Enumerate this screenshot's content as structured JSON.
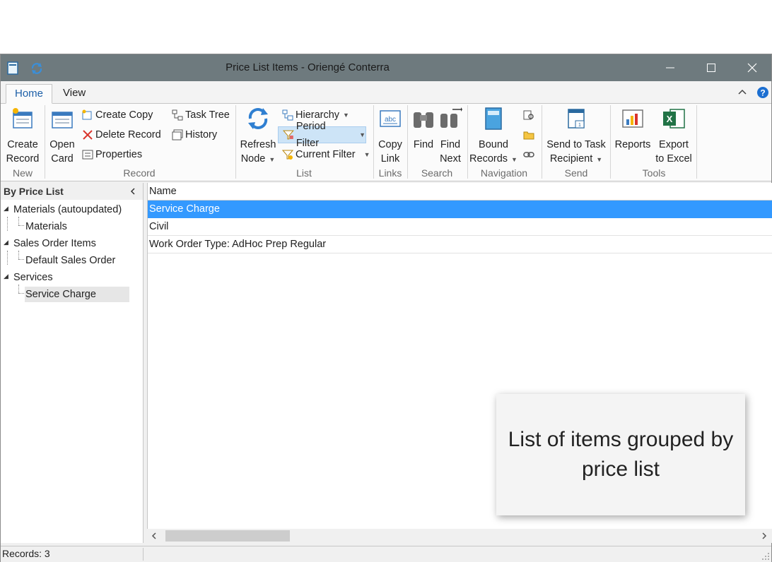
{
  "window": {
    "title": "Price List Items - Oriengé Conterra",
    "buttons": {
      "minimize_icon": "minimize-icon",
      "maximize_icon": "maximize-icon",
      "close_icon": "close-icon"
    }
  },
  "tabs": [
    {
      "label": "Home",
      "active": true
    },
    {
      "label": "View",
      "active": false
    }
  ],
  "ribbon": {
    "groups": {
      "new": "New",
      "record": "Record",
      "list": "List",
      "links": "Links",
      "search": "Search",
      "navigation": "Navigation",
      "send": "Send",
      "tools": "Tools"
    },
    "create_record": [
      "Create",
      "Record"
    ],
    "open_card": [
      "Open",
      "Card"
    ],
    "create_copy": "Create Copy",
    "delete_record": "Delete Record",
    "properties": "Properties",
    "task_tree": "Task Tree",
    "history": "History",
    "refresh_node": [
      "Refresh",
      "Node"
    ],
    "hierarchy": "Hierarchy",
    "period_filter": "Period Filter",
    "current_filter": "Current Filter",
    "copy_link": [
      "Copy",
      "Link"
    ],
    "find": "Find",
    "find_next": [
      "Find",
      "Next"
    ],
    "bound_records": [
      "Bound",
      "Records"
    ],
    "send_to_task_recipient": [
      "Send to Task",
      "Recipient"
    ],
    "reports": "Reports",
    "export_to_excel": [
      "Export",
      "to Excel"
    ]
  },
  "left_panel": {
    "header": "By Price List",
    "tree": [
      {
        "label": "Materials (autoupdated)",
        "children": [
          "Materials"
        ]
      },
      {
        "label": "Sales Order Items",
        "children": [
          "Default Sales Order"
        ]
      },
      {
        "label": "Services",
        "children": [
          "Service Charge"
        ]
      }
    ]
  },
  "grid": {
    "column": "Name",
    "rows": [
      "Service Charge",
      "Civil",
      "Work Order Type: AdHoc Prep Regular"
    ],
    "selected_index": 0
  },
  "status": {
    "records": "Records: 3"
  },
  "callout": "List of items grouped by price list",
  "colors": {
    "titlebar": "#6e7a7e",
    "selection": "#3399ff",
    "accent": "#1c5fa8"
  }
}
